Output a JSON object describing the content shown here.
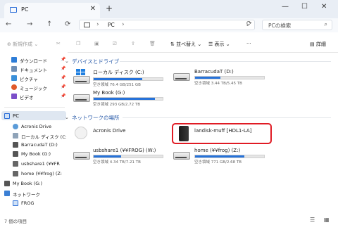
{
  "window": {
    "tab_title": "PC",
    "new_tab": "+",
    "minimize": "—",
    "maximize": "☐",
    "close": "✕"
  },
  "address": {
    "location": "PC",
    "search_placeholder": "PCの検索"
  },
  "toolbar": {
    "new": "新規作成",
    "sort": "並べ替え",
    "view": "表示",
    "details": "詳細"
  },
  "sidebar": {
    "quick": [
      {
        "label": "ダウンロード",
        "icon": "download-icon",
        "color": "#2e7dd7"
      },
      {
        "label": "ドキュメント",
        "icon": "document-icon",
        "color": "#6f8fb5"
      },
      {
        "label": "ピクチャ",
        "icon": "pictures-icon",
        "color": "#3a8fd9"
      },
      {
        "label": "ミュージック",
        "icon": "music-icon",
        "color": "#e05a2a"
      },
      {
        "label": "ビデオ",
        "icon": "video-icon",
        "color": "#7b4fc9"
      }
    ],
    "pc_label": "PC",
    "tree": [
      {
        "label": "Acronis Drive",
        "icon": "cloud-drive-icon"
      },
      {
        "label": "ローカル ディスク (C:",
        "icon": "local-disk-icon"
      },
      {
        "label": "BarracudaT (D:)",
        "icon": "drive-icon"
      },
      {
        "label": "My Book (G:)",
        "icon": "drive-icon"
      },
      {
        "label": "usbshare1 (¥¥FR",
        "icon": "network-drive-icon"
      },
      {
        "label": "home (¥¥frog) (Z:",
        "icon": "network-drive-icon"
      }
    ],
    "extra": [
      {
        "label": "My Book (G:)",
        "icon": "drive-icon"
      },
      {
        "label": "ネットワーク",
        "icon": "network-icon"
      },
      {
        "label": "FROG",
        "icon": "computer-icon"
      }
    ]
  },
  "main": {
    "devices_header": "デバイスとドライブ",
    "network_header": "ネットワークの場所",
    "devices": [
      {
        "name": "ローカル ディスク (C:)",
        "free": "空き領域 76.4 GB/251 GB",
        "used_fraction": 0.7
      },
      {
        "name": "BarracudaT (D:)",
        "free": "空き領域 3.44 TB/5.45 TB",
        "used_fraction": 0.37
      },
      {
        "name": "My Book (G:)",
        "free": "空き領域 293 GB/2.72 TB",
        "used_fraction": 0.89
      }
    ],
    "network": [
      {
        "name": "Acronis Drive"
      },
      {
        "name": "landisk-muff [HDL1-LA]"
      },
      {
        "name": "usbshare1 (¥¥FROG) (W:)",
        "free": "空き領域 4.34 TB/7.21 TB",
        "used_fraction": 0.4
      },
      {
        "name": "home (¥¥frog) (Z:)",
        "free": "空き領域 771 GB/2.68 TB",
        "used_fraction": 0.71
      }
    ]
  },
  "status": {
    "item_count": "7 個の項目"
  },
  "colors": {
    "accent": "#2672d9",
    "highlight": "#e01b24"
  }
}
